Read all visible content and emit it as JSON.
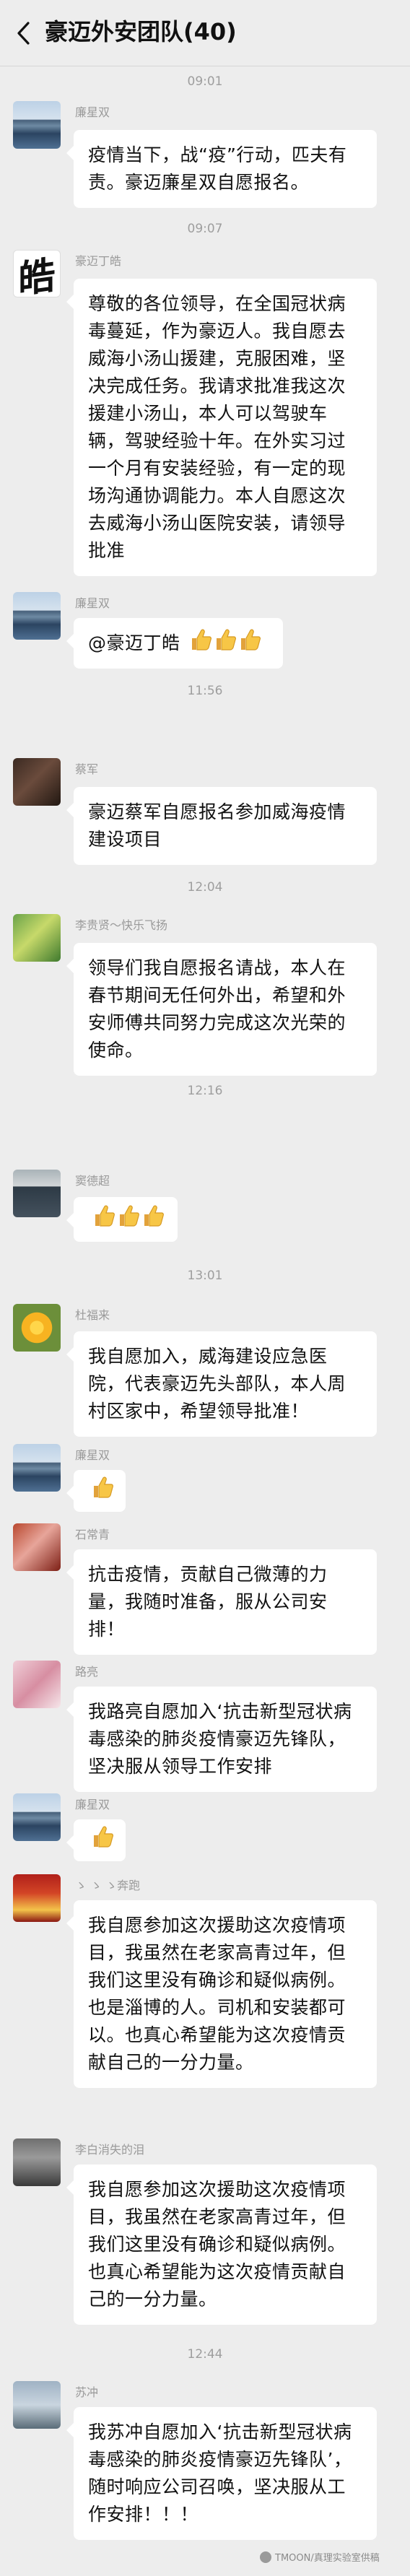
{
  "header": {
    "title": "豪迈外安团队(40)"
  },
  "colors": {
    "background": "#ededed",
    "bubble": "#ffffff",
    "time_text": "#9e9e9e",
    "name_text": "#9a9a9a"
  },
  "times": [
    "09:01",
    "09:07",
    "11:56",
    "12:04",
    "12:16",
    "13:01",
    "12:44"
  ],
  "messages": [
    {
      "sender": "廉星双",
      "text": "疫情当下，战“疫”行动，匹夫有责。豪迈廉星双自愿报名。"
    },
    {
      "sender": "豪迈丁皓",
      "text": "尊敬的各位领导，在全国冠状病毒蔓延，作为豪迈人。我自愿去威海小汤山援建，克服困难，坚决完成任务。我请求批准我这次援建小汤山，本人可以驾驶车辆，驾驶经验十年。在外实习过一个月有安装经验，有一定的现场沟通协调能力。本人自愿这次去威海小汤山医院安装，请领导批准"
    },
    {
      "sender": "廉星双",
      "text": "@豪迈丁皓"
    },
    {
      "sender": "蔡军",
      "text": "豪迈蔡军自愿报名参加威海疫情建设项目"
    },
    {
      "sender": "李贵贤～快乐飞扬",
      "text": "领导们我自愿报名请战，本人在春节期间无任何外出，希望和外安师傅共同努力完成这次光荣的使命。"
    },
    {
      "sender": "窦德超",
      "text": ""
    },
    {
      "sender": "杜福来",
      "text": "我自愿加入，威海建设应急医院，代表豪迈先头部队，本人周村区家中，希望领导批准！"
    },
    {
      "sender": "廉星双",
      "text": ""
    },
    {
      "sender": "石常青",
      "text": "抗击疫情，贡献自己微薄的力量，我随时准备，服从公司安排！"
    },
    {
      "sender": "路亮",
      "text": "我路亮自愿加入‘抗击新型冠状病毒感染的肺炎疫情豪迈先锋队，坚决服从领导工作安排"
    },
    {
      "sender": "廉星双",
      "text": ""
    },
    {
      "sender": "ゝ ゝ ゝ奔跑",
      "text": "我自愿参加这次援助这次疫情项目，我虽然在老家高青过年，但我们这里没有确诊和疑似病例。也是淄博的人。司机和安装都可以。也真心希望能为这次疫情贡献自己的一分力量。"
    },
    {
      "sender": "李白消失的泪",
      "text": "我自愿参加这次援助这次疫情项目，我虽然在老家高青过年，但我们这里没有确诊和疑似病例。也真心希望能为这次疫情贡献自己的一分力量。"
    },
    {
      "sender": "苏冲",
      "text": "我苏冲自愿加入‘抗击新型冠状病毒感染的肺炎疫情豪迈先锋队’，随时响应公司召唤，坚决服从工作安排！！！"
    }
  ],
  "icons": {
    "back": "chevron-left-icon",
    "reaction": "thumbs-up-icon"
  },
  "thumb_counts": {
    "m3": 3,
    "m6": 3,
    "m8": 1,
    "m11": 1
  },
  "avatar_glyph": "皓",
  "watermark": "TMOON/真理实验室供稿"
}
